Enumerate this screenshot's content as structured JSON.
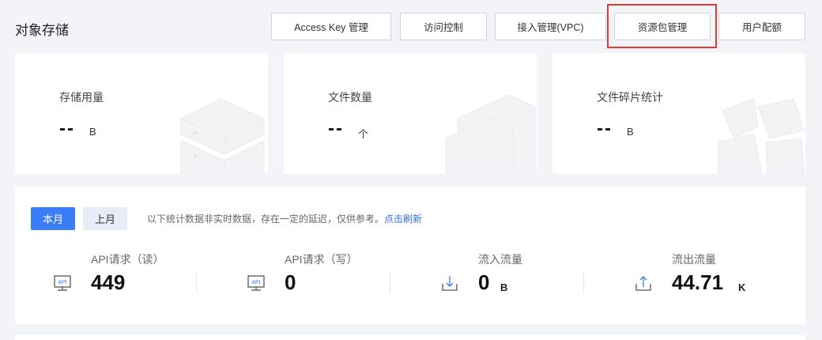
{
  "header": {
    "title": "对象存储"
  },
  "toolbar": {
    "access_key": "Access Key 管理",
    "access_control": "访问控制",
    "vpc": "接入管理(VPC)",
    "resource_pkg": "资源包管理",
    "user_quota": "用户配额"
  },
  "cards": [
    {
      "label": "存储用量",
      "value": "--",
      "unit": "B"
    },
    {
      "label": "文件数量",
      "value": "--",
      "unit": "个"
    },
    {
      "label": "文件碎片统计",
      "value": "--",
      "unit": "B"
    }
  ],
  "stats": {
    "this_month": "本月",
    "last_month": "上月",
    "notice": "以下统计数据非实时数据，存在一定的延迟，仅供参考。",
    "refresh": "点击刷新",
    "items": [
      {
        "label": "API请求（读）",
        "value": "449",
        "unit": "",
        "icon": "api-icon"
      },
      {
        "label": "API请求（写）",
        "value": "0",
        "unit": "",
        "icon": "api-icon"
      },
      {
        "label": "流入流量",
        "value": "0",
        "unit": "B",
        "icon": "download-icon"
      },
      {
        "label": "流出流量",
        "value": "44.71",
        "unit": "K",
        "icon": "upload-icon"
      }
    ]
  },
  "colors": {
    "accent": "#3a7df6",
    "highlight": "#e53935",
    "link": "#2f6fe8"
  }
}
